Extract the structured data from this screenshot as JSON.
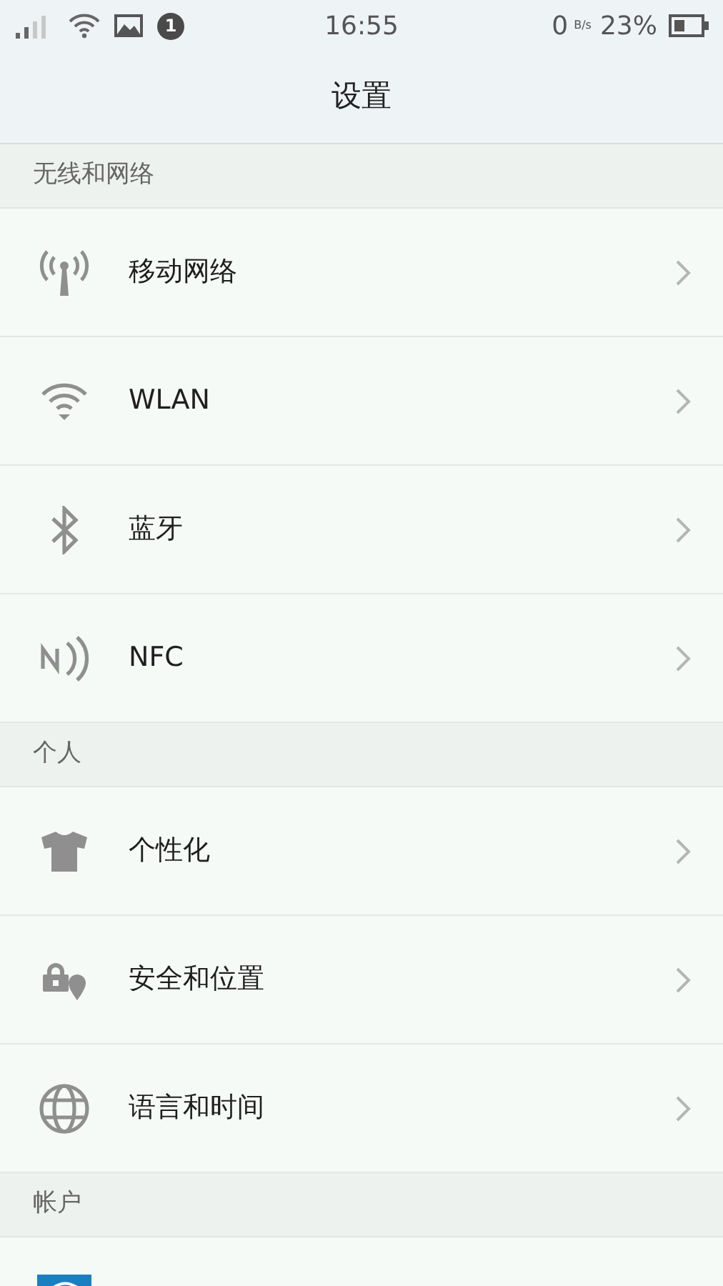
{
  "status_bar": {
    "notification_count": "1",
    "time": "16:55",
    "speed": "0",
    "speed_unit": "B/s",
    "battery": "23%"
  },
  "title": "设置",
  "sections": [
    {
      "header": "无线和网络",
      "items": [
        {
          "kind": "antenna",
          "label": "移动网络"
        },
        {
          "kind": "wifi",
          "label": "WLAN"
        },
        {
          "kind": "bluetooth",
          "label": "蓝牙"
        },
        {
          "kind": "nfc",
          "label": "NFC"
        }
      ]
    },
    {
      "header": "个人",
      "items": [
        {
          "kind": "shirt",
          "label": "个性化"
        },
        {
          "kind": "lock",
          "label": "安全和位置"
        },
        {
          "kind": "globe",
          "label": "语言和时间"
        }
      ]
    },
    {
      "header": "帐户",
      "items": [
        {
          "kind": "account"
        }
      ]
    }
  ]
}
